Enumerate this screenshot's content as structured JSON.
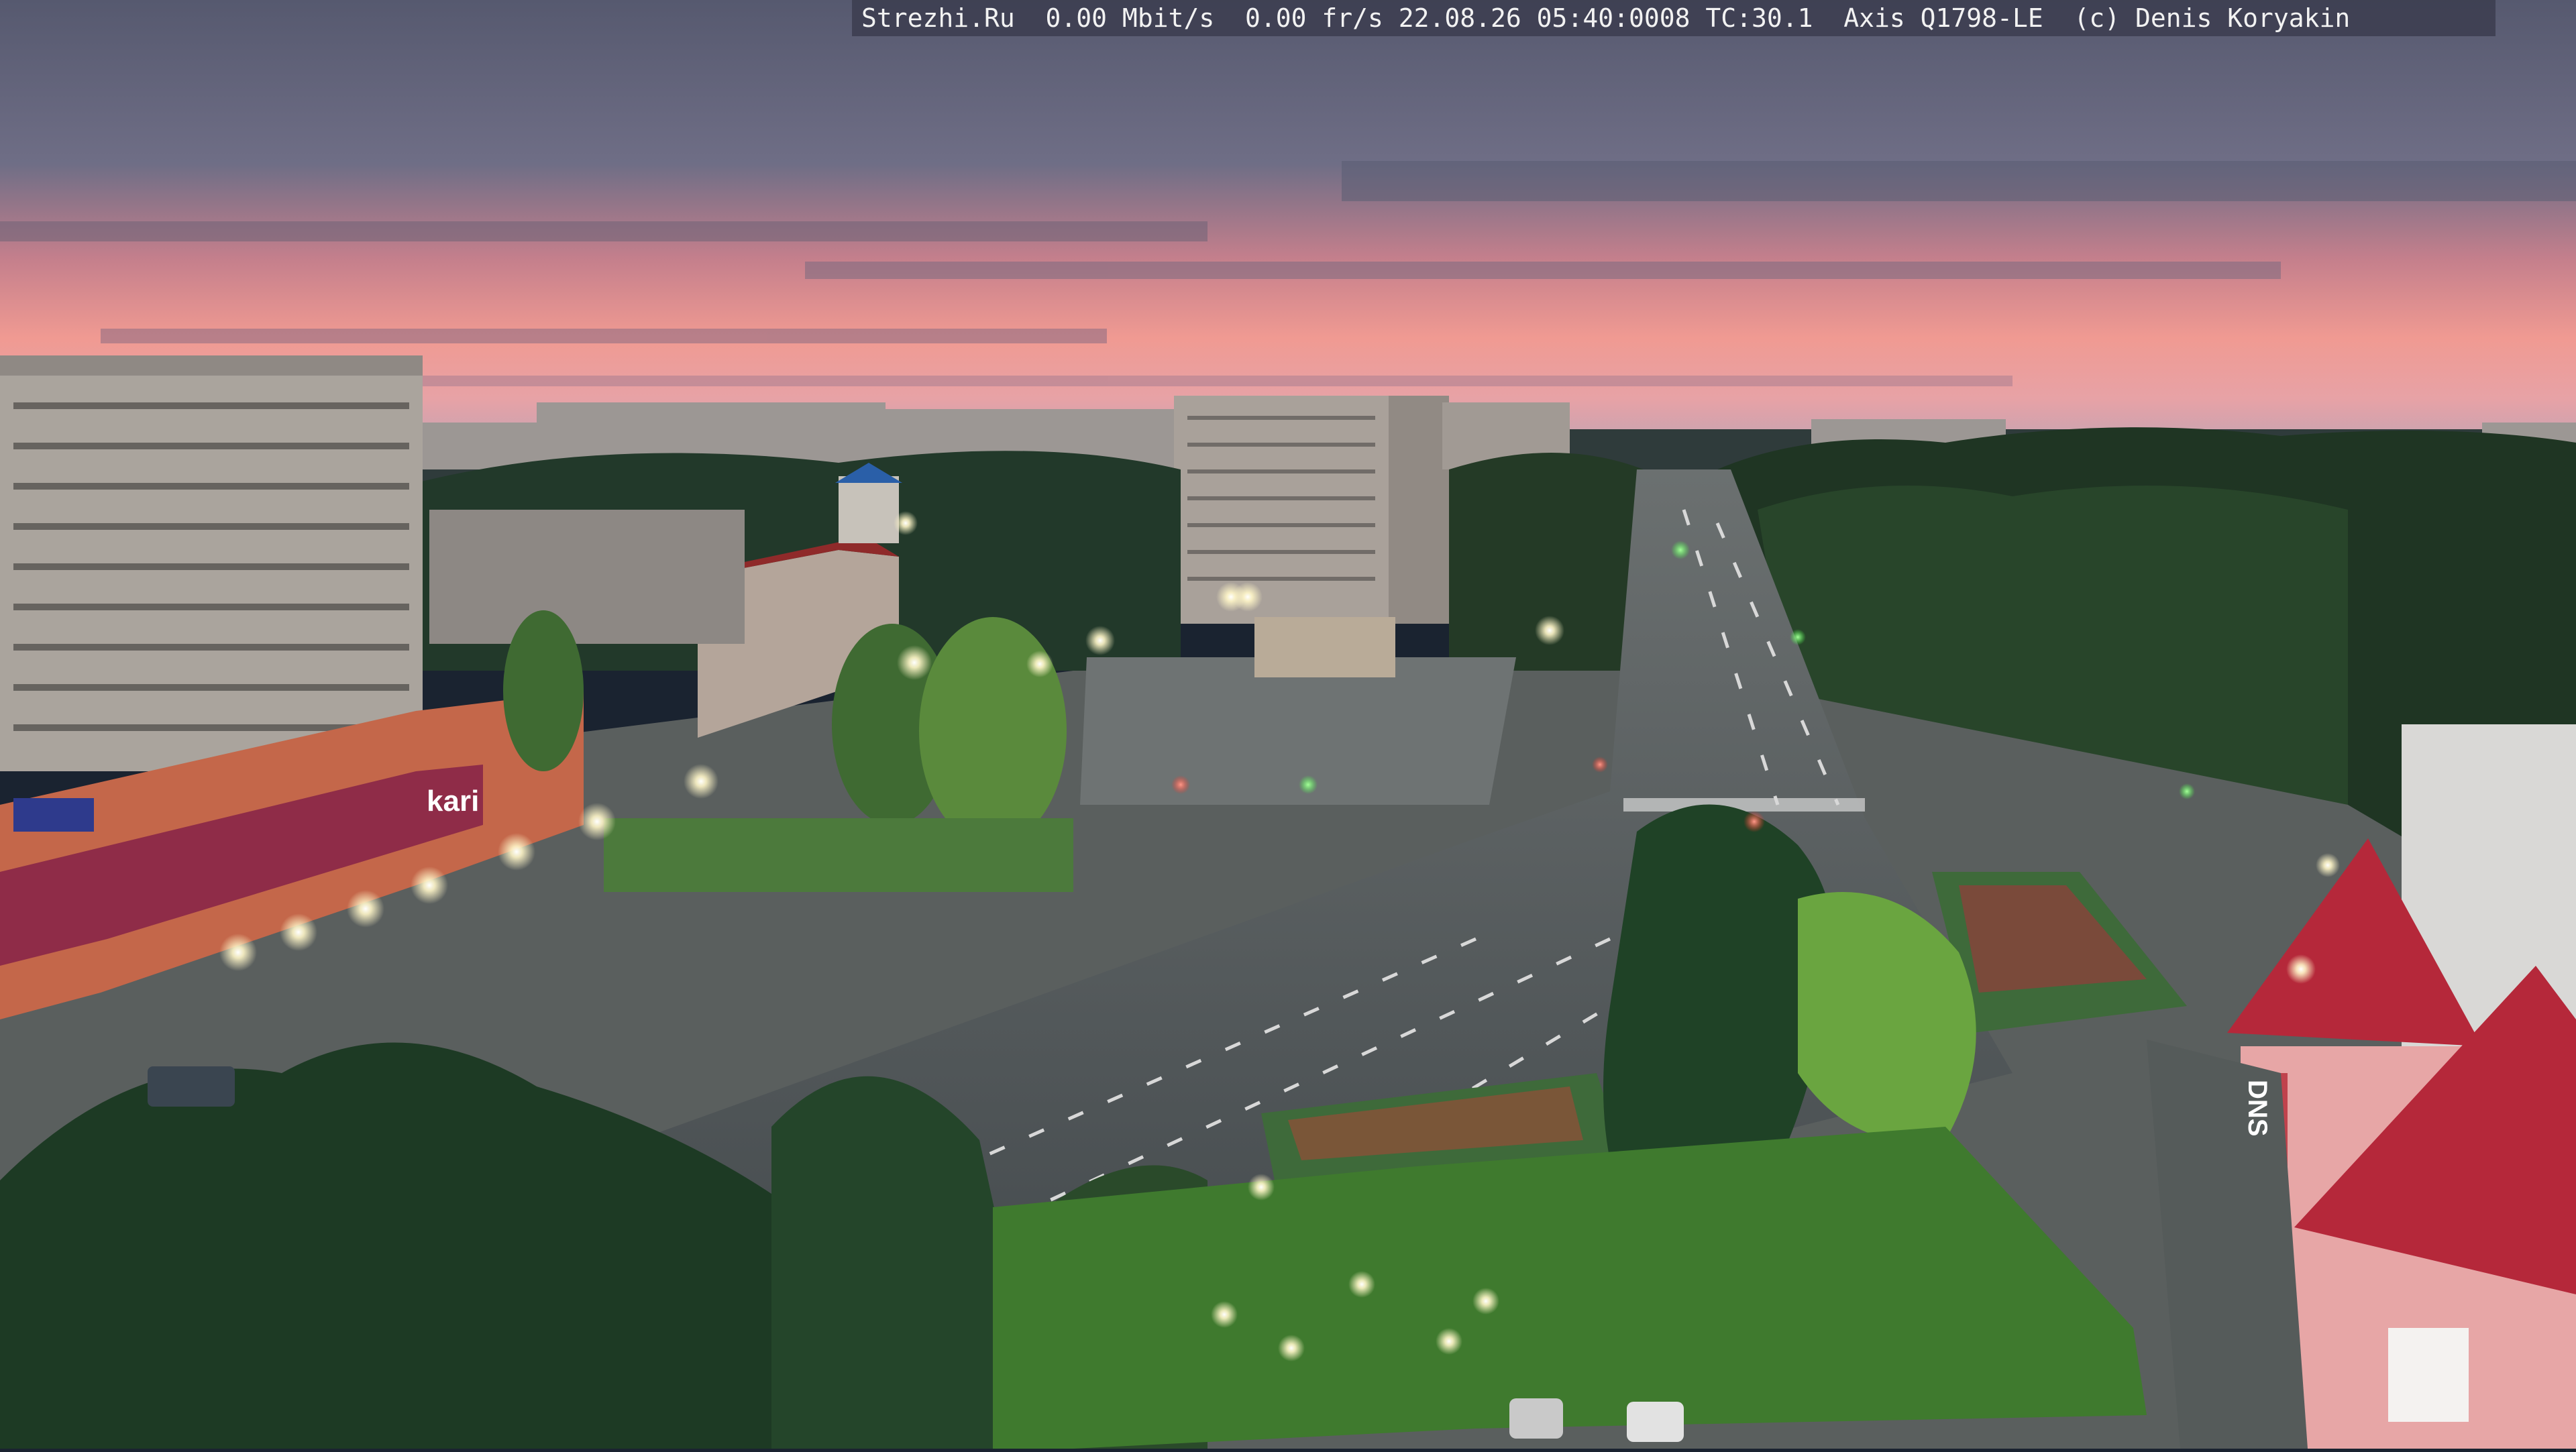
{
  "overlay": {
    "site": "Strezhi.Ru",
    "bitrate": "0.00 Mbit/s",
    "framerate": "0.00 fr/s",
    "datetime": "22.08.26 05:40:0008",
    "tc": "TC:30.1",
    "camera": "Axis Q1798-LE",
    "copyright": "(c) Denis Koryakin"
  },
  "signs": {
    "store": "kari",
    "mall": "DNS"
  },
  "colors": {
    "sky_top": "#5c5f78",
    "sky_pink": "#e88a8c",
    "horizon": "#f0a49a",
    "trees_dark": "#1f3a24",
    "trees_light": "#3f6e2f",
    "road": "#4f5558",
    "building_panel": "#a9a39c",
    "building_orange": "#c96a4a",
    "roof_red": "#b5283a"
  }
}
